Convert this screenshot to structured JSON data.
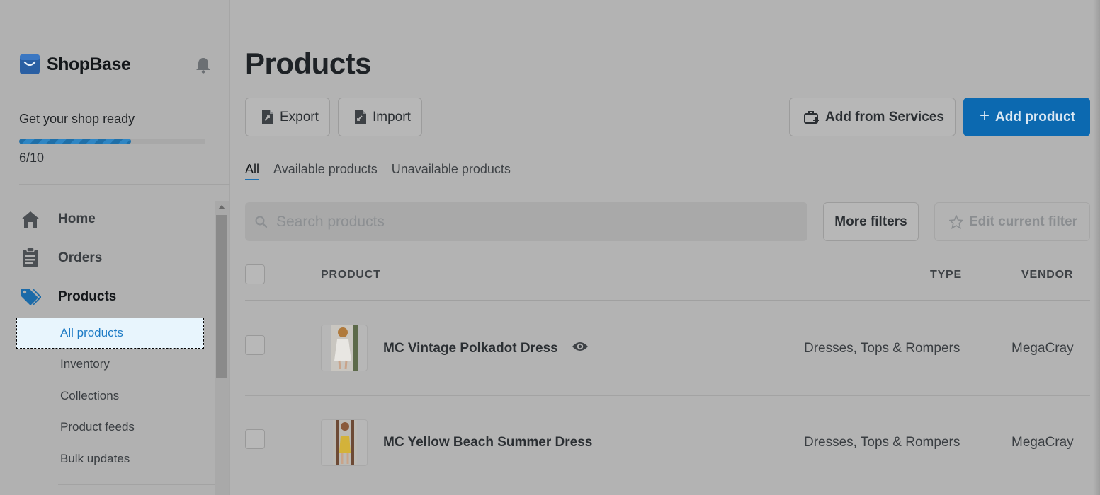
{
  "brand": {
    "name": "ShopBase"
  },
  "onboarding": {
    "title": "Get your shop ready",
    "progress_text": "6/10",
    "progress": 0.6
  },
  "nav": {
    "home": "Home",
    "orders": "Orders",
    "products": "Products",
    "sub": [
      "All products",
      "Inventory",
      "Collections",
      "Product feeds",
      "Bulk updates"
    ]
  },
  "page": {
    "title": "Products"
  },
  "actions": {
    "export": "Export",
    "import": "Import",
    "add_from_services": "Add from Services",
    "add_product": "Add product"
  },
  "tabs": [
    "All",
    "Available products",
    "Unavailable products"
  ],
  "search": {
    "placeholder": "Search products"
  },
  "filters": {
    "more": "More filters",
    "edit": "Edit current filter"
  },
  "table": {
    "columns": [
      "PRODUCT",
      "TYPE",
      "VENDOR"
    ],
    "rows": [
      {
        "name": "MC Vintage Polkadot Dress",
        "type": "Dresses, Tops & Rompers",
        "vendor": "MegaCray"
      },
      {
        "name": "MC Yellow Beach Summer Dress",
        "type": "Dresses, Tops & Rompers",
        "vendor": "MegaCray"
      }
    ]
  },
  "colors": {
    "accent": "#0c69b0",
    "active_link": "#1d7bc5",
    "progress": "#1f6fa8"
  }
}
